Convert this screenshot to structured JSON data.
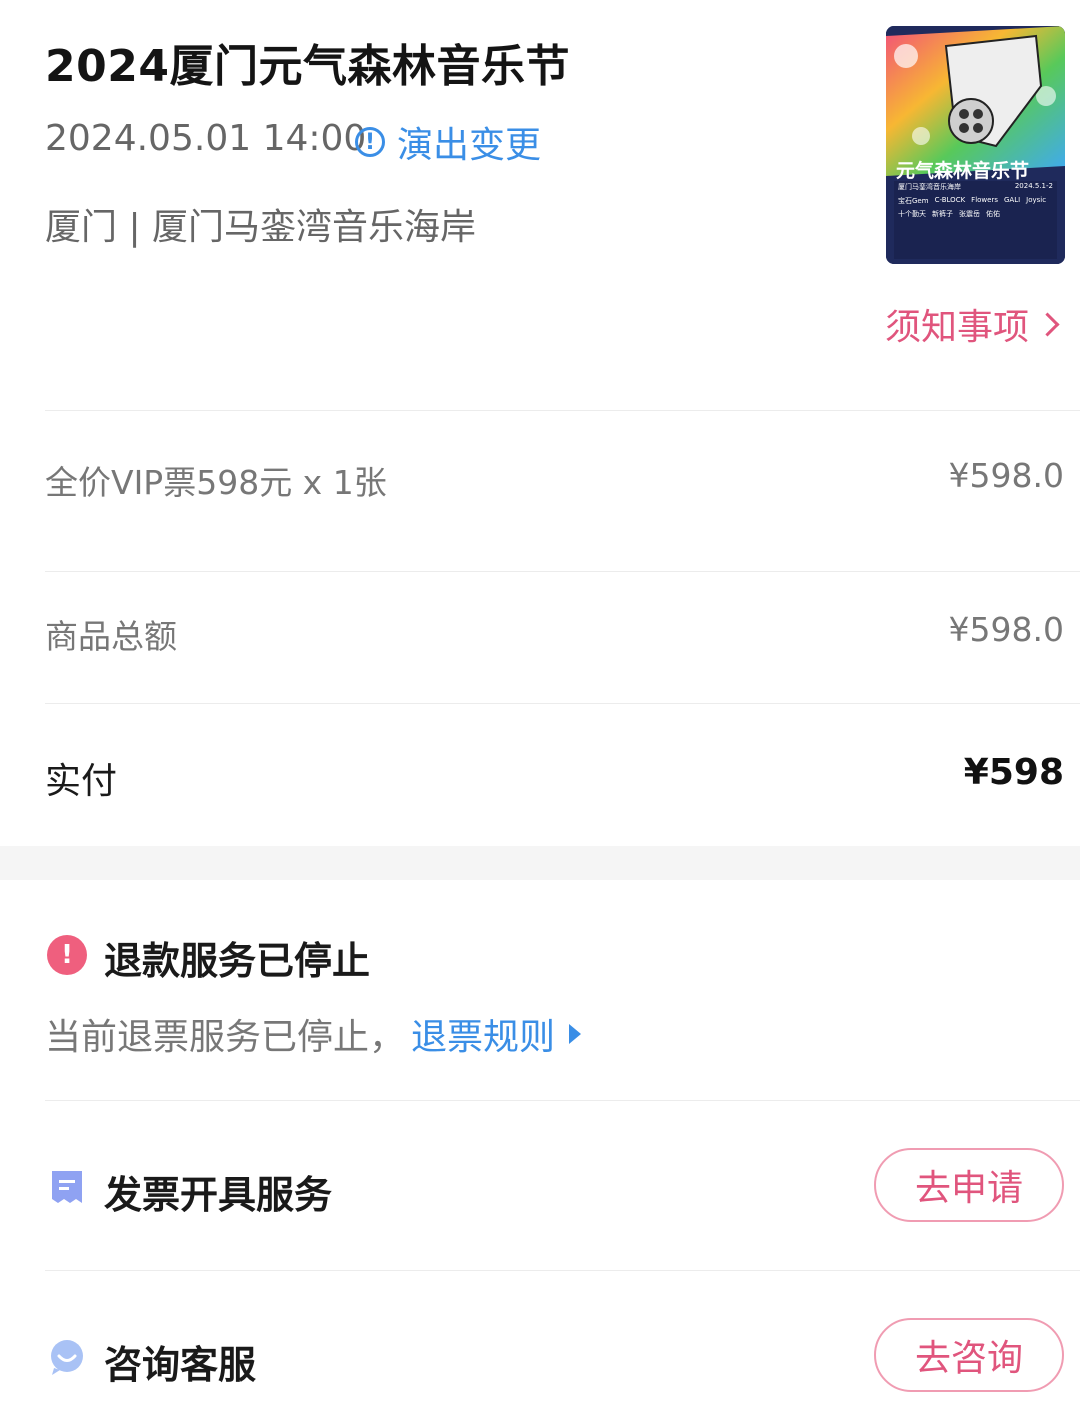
{
  "event": {
    "title": "2024厦门元气森林音乐节",
    "datetime": "2024.05.01 14:00",
    "change_label": "演出变更",
    "venue": "厦门 | 厦门马銮湾音乐海岸",
    "notice_label": "须知事项",
    "poster": {
      "title_text": "元气森林音乐节",
      "subtitle_text": "厦门马銮湾音乐海岸",
      "date_text": "2024.5.1-2",
      "lineup": [
        "宝石Gem",
        "C-BLOCK",
        "Flowers",
        "GALI",
        "Joysic",
        "十个勤天",
        "新裤子",
        "张震岳",
        "佑佑"
      ],
      "colors": [
        "#f24f7a",
        "#f7b733",
        "#3fa9f5",
        "#1f2a5c"
      ]
    }
  },
  "order": {
    "ticket_line": "全价VIP票598元 x 1张",
    "ticket_price": "¥598.0",
    "subtotal_label": "商品总额",
    "subtotal_value": "¥598.0",
    "paid_label": "实付",
    "paid_value": "¥598"
  },
  "refund": {
    "title": "退款服务已停止",
    "desc": "当前退票服务已停止，",
    "rules_link": "退票规则"
  },
  "services": [
    {
      "title": "发票开具服务",
      "button": "去申请",
      "icon": "invoice-icon"
    },
    {
      "title": "咨询客服",
      "button": "去咨询",
      "icon": "chat-icon"
    }
  ],
  "accent_colors": {
    "link": "#3a8ee6",
    "pink": "#e0557d"
  }
}
